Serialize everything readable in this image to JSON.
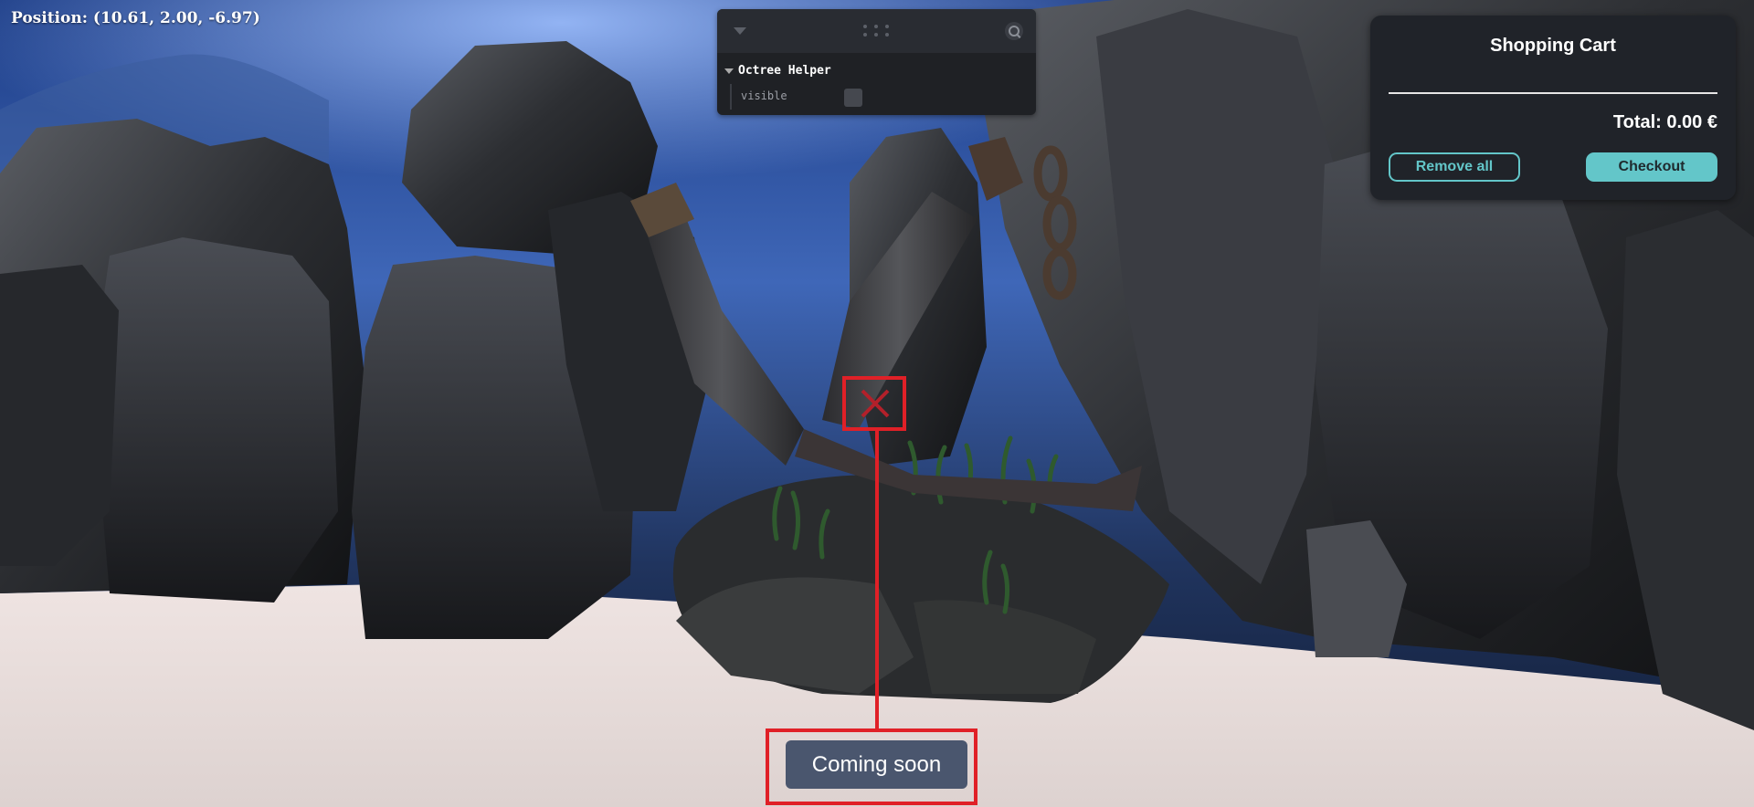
{
  "hud": {
    "position_text": "Position: (10.61, 2.00, -6.97)"
  },
  "gui": {
    "folder_label": "Octree Helper",
    "visible_label": "visible",
    "visible_checked": false
  },
  "cart": {
    "title": "Shopping Cart",
    "total_text": "Total: 0.00 €",
    "remove_all_label": "Remove all",
    "checkout_label": "Checkout"
  },
  "coming_soon": {
    "label": "Coming soon"
  },
  "colors": {
    "accent": "#63c6c9",
    "highlight": "#e02027",
    "button": "#4a566e"
  }
}
